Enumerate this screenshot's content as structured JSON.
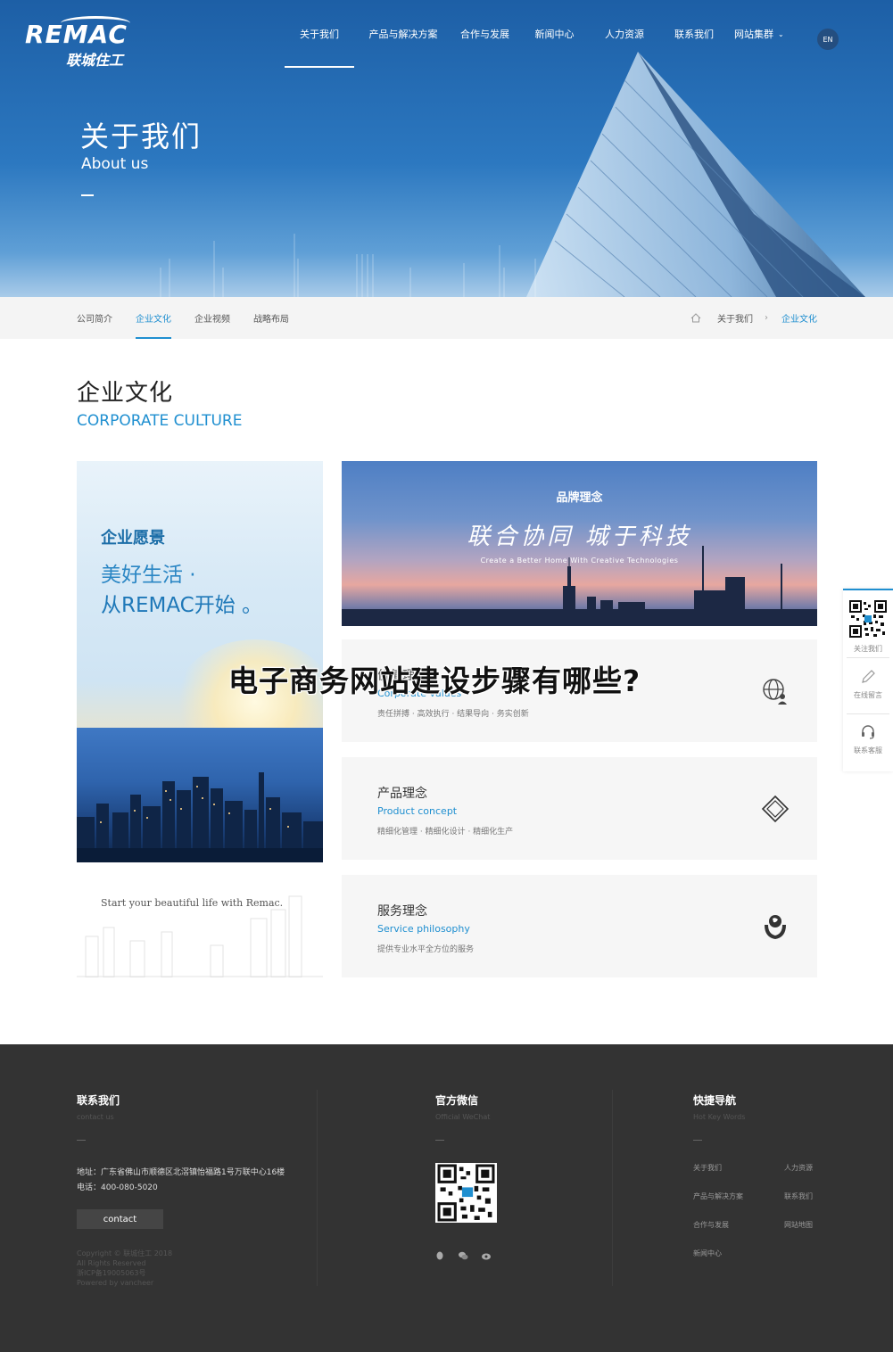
{
  "header": {
    "logo_text": "REMAC",
    "logo_sub": "联城住工",
    "nav": [
      {
        "label": "关于我们"
      },
      {
        "label": "产品与解决方案"
      },
      {
        "label": "合作与发展"
      },
      {
        "label": "新闻中心"
      },
      {
        "label": "人力资源"
      },
      {
        "label": "联系我们"
      },
      {
        "label": "网站集群"
      }
    ],
    "lang": "EN"
  },
  "hero": {
    "title": "关于我们",
    "subtitle": "About us"
  },
  "subnav": {
    "tabs": [
      {
        "label": "公司简介"
      },
      {
        "label": "企业文化"
      },
      {
        "label": "企业视频"
      },
      {
        "label": "战略布局"
      }
    ],
    "breadcrumb": [
      {
        "label": "关于我们"
      },
      {
        "label": "企业文化"
      }
    ],
    "separator": "›"
  },
  "section": {
    "title": "企业文化",
    "subtitle": "CORPORATE CULTURE"
  },
  "vision": {
    "title": "企业愿景",
    "line1": "美好生活 ·",
    "line2": "从REMAC开始 。",
    "tagline": "Start your beautiful life with Remac."
  },
  "brand": {
    "title": "品牌理念",
    "slogan": "联合协同  城于科技",
    "slogan_en": "Create a Better Home With Creative Technologies"
  },
  "concepts": [
    {
      "title": "价值理念",
      "en": "Corporate values",
      "desc": "责任拼搏 · 高效执行 · 结果导向 · 务实创新",
      "icon": "globe-person-icon"
    },
    {
      "title": "产品理念",
      "en": "Product concept",
      "desc": "精细化管理 · 精细化设计 · 精细化生产",
      "icon": "diamond-icon"
    },
    {
      "title": "服务理念",
      "en": "Service philosophy",
      "desc": "提供专业水平全方位的服务",
      "icon": "hands-globe-icon"
    }
  ],
  "headline": "电子商务网站建设步骤有哪些?",
  "float_sidebar": [
    {
      "label": "关注我们",
      "icon": "qr-code-icon"
    },
    {
      "label": "在线留言",
      "icon": "pencil-icon"
    },
    {
      "label": "联系客服",
      "icon": "headset-icon"
    }
  ],
  "footer": {
    "contact": {
      "title": "联系我们",
      "sub": "contact us",
      "address": "地址：广东省佛山市顺德区北滘镇怡福路1号万联中心16楼",
      "phone": "电话：400-080-5020",
      "button": "contact",
      "copyright": [
        "Copyright © 联城住工 2018",
        "All Rights Reserved",
        "浙ICP备19005063号",
        "Powered by vancheer"
      ]
    },
    "wechat": {
      "title": "官方微信",
      "sub": "Official WeChat"
    },
    "quicknav": {
      "title": "快捷导航",
      "sub": "Hot Key Words",
      "links": [
        "关于我们",
        "人力资源",
        "产品与解决方案",
        "联系我们",
        "合作与发展",
        "网站地图",
        "新闻中心"
      ]
    },
    "social_icons": [
      "qq-icon",
      "wechat-icon",
      "weibo-icon"
    ]
  },
  "colors": {
    "accent": "#1f8fd0",
    "footer_bg": "#333333",
    "hero_blue": "#2c78c0"
  }
}
